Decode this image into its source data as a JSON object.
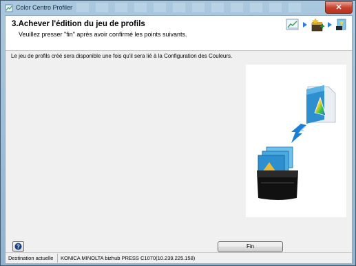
{
  "window": {
    "title": "Color Centro Profiler",
    "close_glyph": "✕"
  },
  "header": {
    "title": "3.Achever l'édition du jeu de profils",
    "subtitle": "Veuillez presser \"fin\" après avoir confirmé les points suivants.",
    "step_icons": [
      "chart-icon",
      "arrow-right-icon",
      "box-star-icon",
      "arrow-right-icon",
      "profile-done-icon"
    ]
  },
  "main": {
    "info_text": "Le jeu de profils créé sera disponible une fois qu'il sera lié à la Configuration des Couleurs.",
    "illustration": [
      "color-profile-file-icon",
      "arrow-down-icon",
      "profile-box-icon"
    ]
  },
  "footer": {
    "help_icon": "question-icon",
    "finish_label": "Fin"
  },
  "status": {
    "label": "Destination actuelle",
    "value": "KONICA MINOLTA bizhub PRESS C1070(10.239.225.158)"
  },
  "colors": {
    "accent_blue": "#2b7fd6",
    "close_red": "#c8422e"
  }
}
